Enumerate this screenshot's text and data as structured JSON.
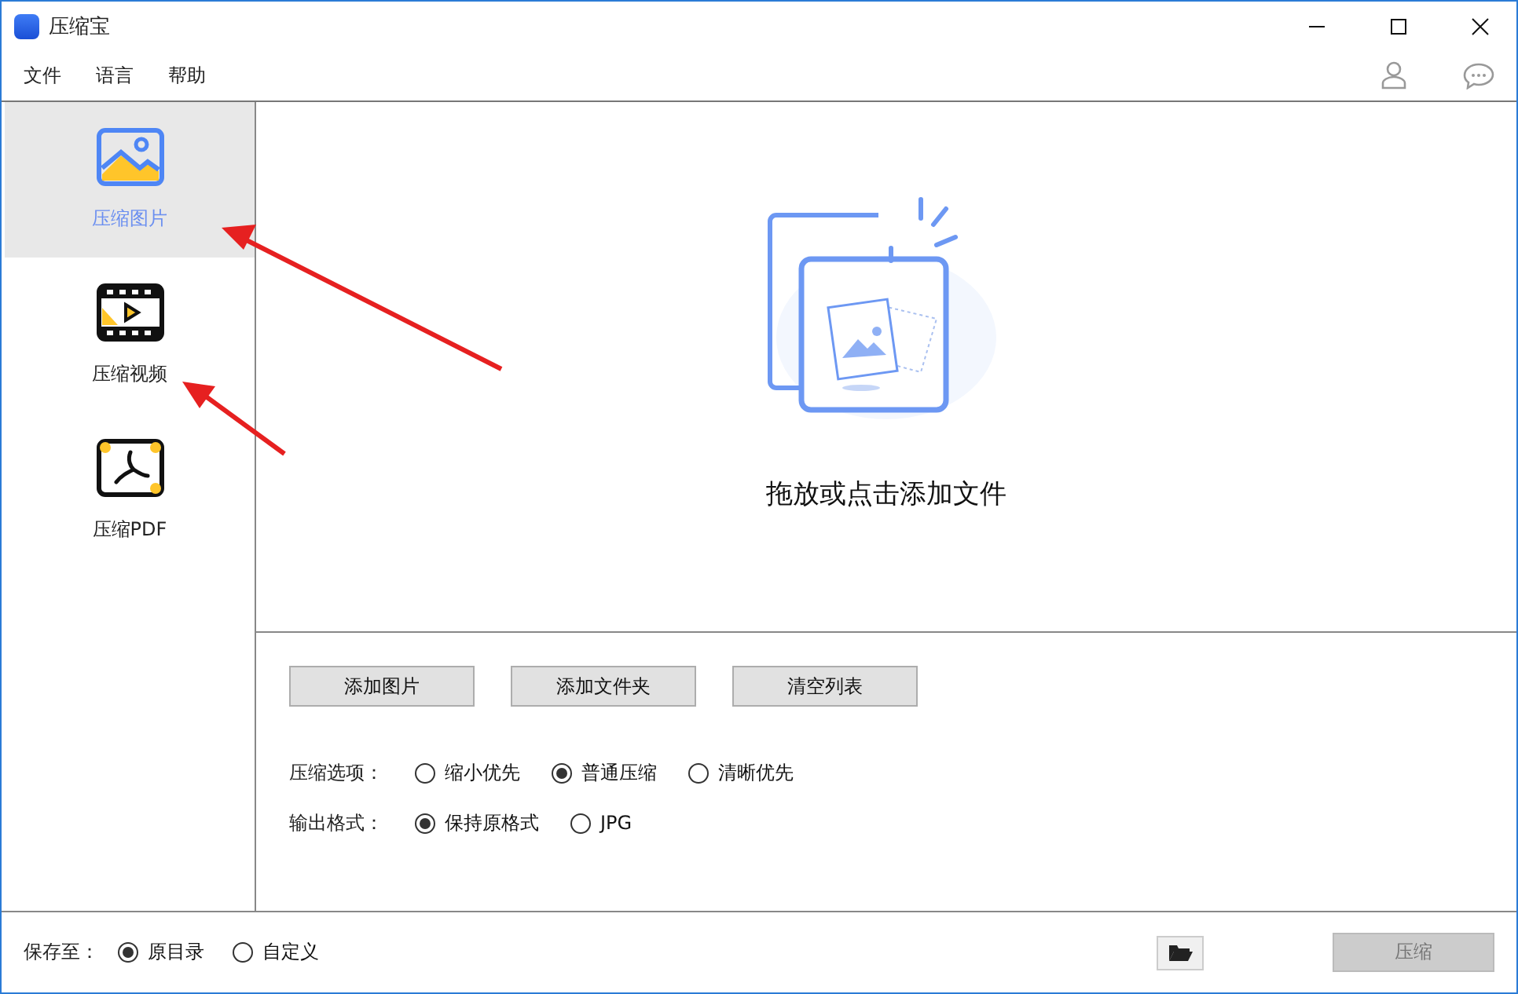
{
  "window": {
    "title": "压缩宝"
  },
  "menu": [
    "文件",
    "语言",
    "帮助"
  ],
  "sidebar": {
    "items": [
      {
        "label": "压缩图片",
        "kind": "image",
        "selected": true
      },
      {
        "label": "压缩视频",
        "kind": "video",
        "selected": false
      },
      {
        "label": "压缩PDF",
        "kind": "pdf",
        "selected": false
      }
    ]
  },
  "drop_zone": {
    "hint": "拖放或点击添加文件"
  },
  "buttons": [
    "添加图片",
    "添加文件夹",
    "清空列表"
  ],
  "options": [
    {
      "label": "压缩选项：",
      "choices": [
        {
          "label": "缩小优先",
          "selected": false
        },
        {
          "label": "普通压缩",
          "selected": true
        },
        {
          "label": "清晰优先",
          "selected": false
        }
      ]
    },
    {
      "label": "输出格式：",
      "choices": [
        {
          "label": "保持原格式",
          "selected": true
        },
        {
          "label": "JPG",
          "selected": false
        }
      ]
    }
  ],
  "footer": {
    "save_to": {
      "label": "保存至：",
      "choices": [
        {
          "label": "原目录",
          "selected": true
        },
        {
          "label": "自定义",
          "selected": false
        }
      ]
    },
    "compress_button": {
      "label": "压缩",
      "disabled": true
    }
  }
}
